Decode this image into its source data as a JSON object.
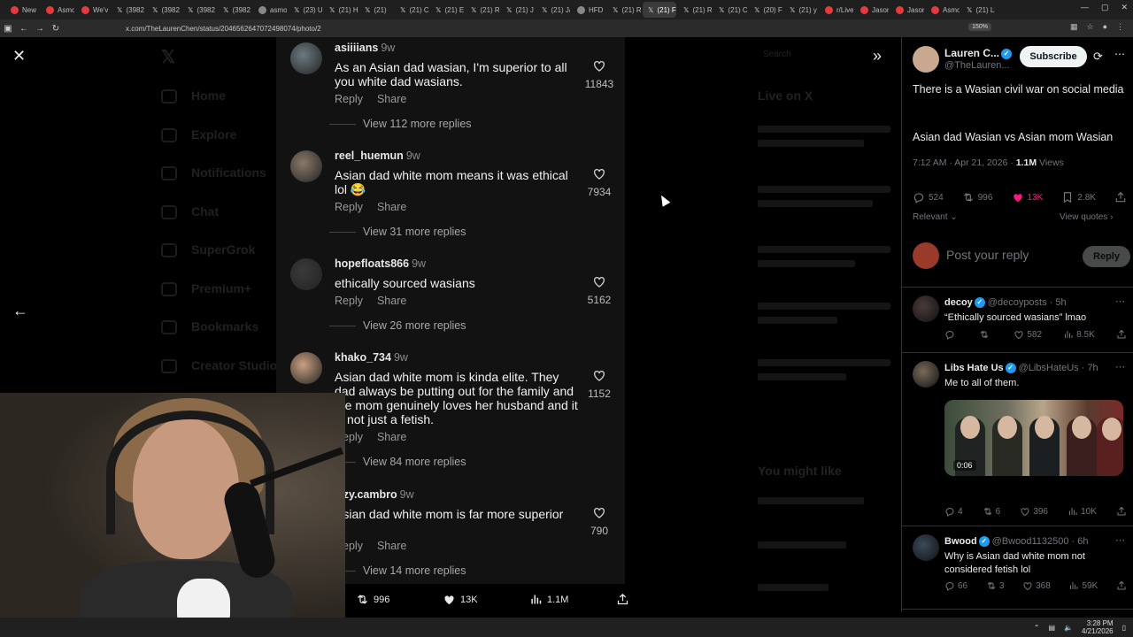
{
  "browser": {
    "tabs": [
      "New",
      "Asmo",
      "We'v",
      "(3982",
      "(3982",
      "(3982",
      "(3982",
      "asmo",
      "(23) U",
      "(21) H",
      "(21)",
      "(21) C",
      "(21) E",
      "(21) R",
      "(21) J",
      "(21) Ja",
      "HFD -",
      "(21) R",
      "(21) F",
      "(21) R",
      "(21) C",
      "(20) F",
      "(21) y",
      "r/Live",
      "Jason",
      "Jason",
      "Asmo",
      "(21) Li"
    ],
    "active_tab_index": 18,
    "url": "x.com/TheLaurenChen/status/2046562647072498074/photo/2",
    "zoom": "150%"
  },
  "background_nav": [
    "Home",
    "Explore",
    "Notifications",
    "Chat",
    "SuperGrok",
    "Premium+",
    "Bookmarks",
    "Creator Studio"
  ],
  "background_right": {
    "search": "Search",
    "live_title": "Live on X",
    "you_might_like": "You might like"
  },
  "comments": [
    {
      "user": "asiiiians",
      "time": "9w",
      "text": "As an Asian dad wasian, I'm superior to all you white dad wasians.",
      "likes": "11843",
      "reply": "Reply",
      "share": "Share",
      "more": "View 112 more replies",
      "avatar_color": "#6a7a80"
    },
    {
      "user": "reel_huemun",
      "time": "9w",
      "text": "Asian dad white mom means it was ethical lol 😂",
      "likes": "7934",
      "reply": "Reply",
      "share": "Share",
      "more": "View 31 more replies",
      "avatar_color": "#8a7a6a"
    },
    {
      "user": "hopefloats866",
      "time": "9w",
      "text": "ethically sourced wasians",
      "likes": "5162",
      "reply": "Reply",
      "share": "Share",
      "more": "View 26 more replies",
      "avatar_color": "#3a3a3a"
    },
    {
      "user": "khako_734",
      "time": "9w",
      "text": "Asian dad white mom is kinda elite. They dad always be putting out for the family and the mom genuinely loves her husband and it is not just a fetish.",
      "likes": "1152",
      "reply": "Reply",
      "share": "Share",
      "more": "View 84 more replies",
      "avatar_color": "#c9a080"
    },
    {
      "user": "izzy.cambro",
      "time": "9w",
      "text": "Asian dad white mom is far more superior",
      "likes": "790",
      "reply": "Reply",
      "share": "Share",
      "more": "View 14 more replies",
      "avatar_color": "#5a4a4a"
    }
  ],
  "media_bar": {
    "retweets": "996",
    "likes": "13K",
    "views": "1.1M"
  },
  "tweet": {
    "author_name": "Lauren C...",
    "author_handle": "@TheLauren...",
    "subscribe_label": "Subscribe",
    "text_line1": "There is a Wasian civil war on social media",
    "text_line2": "Asian dad Wasian vs Asian mom Wasian",
    "time": "7:12 AM · Apr 21, 2026 · ",
    "views_count": "1.1M",
    "views_label": " Views",
    "stats": {
      "replies": "524",
      "retweets": "996",
      "likes": "13K",
      "bookmarks": "2.8K"
    },
    "sort_label": "Relevant",
    "view_quotes": "View quotes",
    "reply_placeholder": "Post your reply",
    "reply_button": "Reply"
  },
  "replies": [
    {
      "name": "decoy",
      "handle": "@decoyposts · 5h",
      "text": "“Ethically sourced wasians” lmao",
      "retweets": "",
      "likes": "582",
      "views": "8.5K",
      "comments": "",
      "avatar_color": "#4a3a3a"
    },
    {
      "name": "Libs Hate Us",
      "handle": "@LibsHateUs · 7h",
      "text": "Me to all of them.",
      "comments": "4",
      "retweets": "6",
      "likes": "396",
      "views": "10K",
      "video_time": "0:06",
      "avatar_color": "#7a6a5a"
    },
    {
      "name": "Bwood",
      "handle": "@Bwood1132500 · 6h",
      "text": "Why is Asian dad white mom not considered fetish lol",
      "comments": "66",
      "retweets": "3",
      "likes": "368",
      "views": "59K",
      "avatar_color": "#3a4a5a"
    }
  ],
  "taskbar": {
    "time": "3:28 PM",
    "date": "4/21/2026"
  },
  "colors": {
    "like_pink": "#f91880",
    "verified_blue": "#1d9bf0",
    "panel_bg": "#121212"
  }
}
